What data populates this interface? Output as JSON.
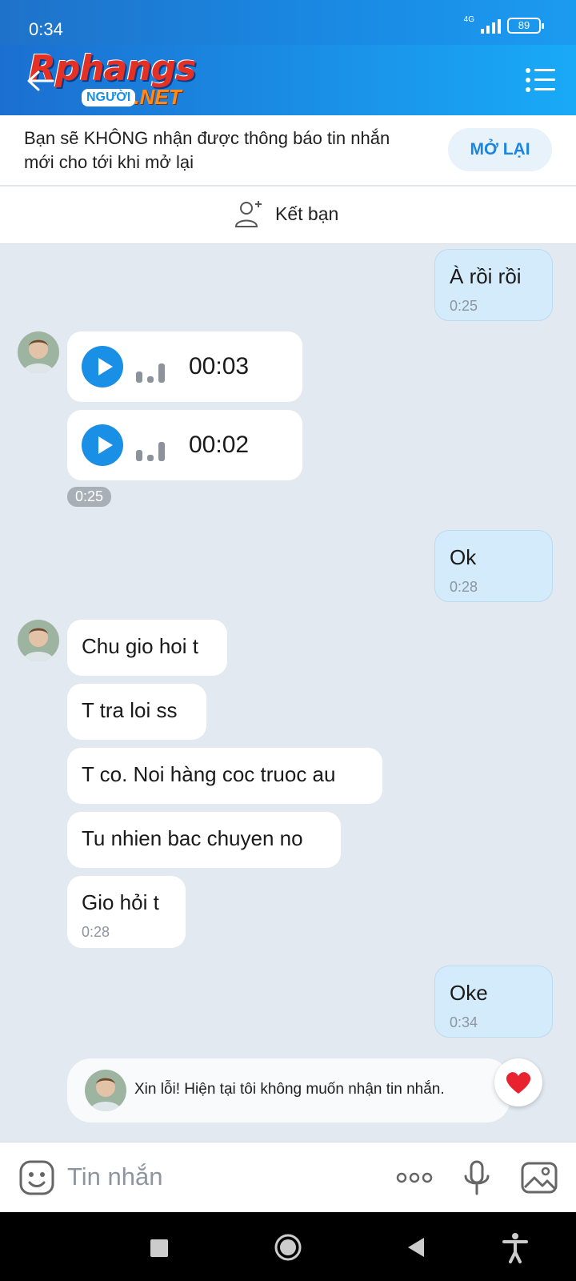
{
  "status_bar": {
    "time": "0:34",
    "network": "4G",
    "battery": "89"
  },
  "header": {
    "logo_main": "Rphangs",
    "logo_sub_badge": "NGƯỜI",
    "logo_sub_net": ".NET"
  },
  "notice": {
    "text": "Bạn sẽ KHÔNG nhận được thông báo tin nhắn mới cho tới khi mở lại",
    "reopen_label": "MỞ LẠI"
  },
  "friend": {
    "label": "Kết bạn"
  },
  "messages": [
    {
      "from": "me",
      "text": "À rồi rồi",
      "time": "0:25"
    },
    {
      "from": "other",
      "type": "voice",
      "duration": "00:03"
    },
    {
      "from": "other",
      "type": "voice",
      "duration": "00:02",
      "time": "0:25"
    },
    {
      "from": "me",
      "text": "Ok",
      "time": "0:28"
    },
    {
      "from": "other",
      "text": "Chu gio hoi t"
    },
    {
      "from": "other",
      "text": "T tra loi ss"
    },
    {
      "from": "other",
      "text": "T co. Noi hàng coc truoc au"
    },
    {
      "from": "other",
      "text": "Tu nhien bac chuyen no"
    },
    {
      "from": "other",
      "text": "Gio hỏi t",
      "time": "0:28"
    },
    {
      "from": "me",
      "text": "Oke",
      "time": "0:34"
    }
  ],
  "auto_reply": {
    "text": "Xin lỗi! Hiện tại tôi không muốn nhận tin nhắn."
  },
  "input": {
    "placeholder": "Tin nhắn"
  },
  "colors": {
    "accent": "#1a8fe6",
    "my_bubble": "#d4ebfb",
    "chat_bg": "#e2e9f1"
  }
}
